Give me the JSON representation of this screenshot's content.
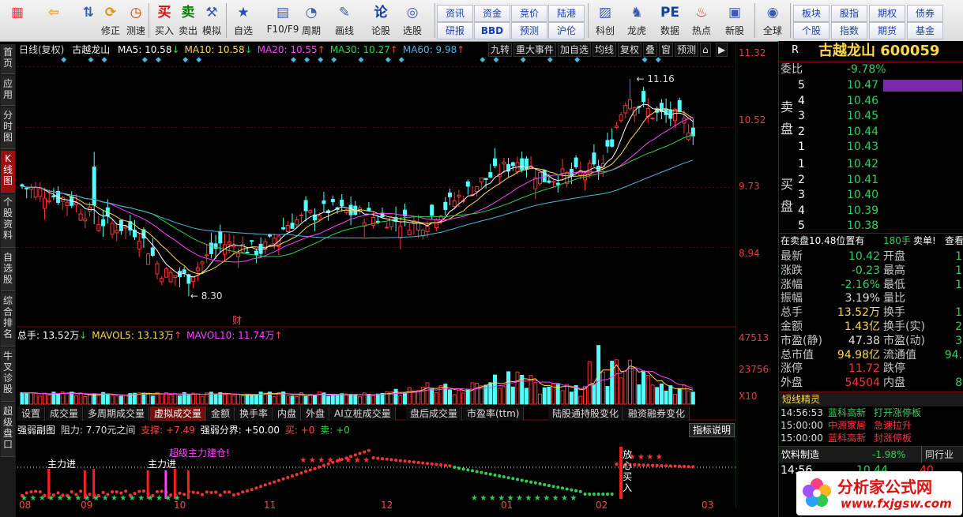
{
  "toolbar": {
    "main": [
      {
        "label": "",
        "icon": "app-grid-icon"
      },
      {
        "label": "",
        "icon": "back-arrow-icon"
      },
      {
        "label": "",
        "icon": "up-down-icon"
      },
      {
        "label": "修正",
        "icon": "refresh-icon"
      },
      {
        "label": "测速",
        "icon": "clock-icon"
      },
      {
        "label": "买入",
        "icon": "buy-icon",
        "glyph": "买"
      },
      {
        "label": "卖出",
        "icon": "sell-icon",
        "glyph": "卖"
      },
      {
        "label": "模拟",
        "icon": "hammer-icon"
      },
      {
        "label": "自选",
        "icon": "star-icon"
      },
      {
        "label": "F10/F9",
        "icon": "f10-icon"
      },
      {
        "label": "周期",
        "icon": "period-icon"
      },
      {
        "label": "画线",
        "icon": "pen-icon"
      },
      {
        "label": "论股",
        "icon": "forum-icon",
        "glyph": "论"
      },
      {
        "label": "选股",
        "icon": "select-icon"
      },
      {
        "label": "科创",
        "icon": "tech-icon"
      },
      {
        "label": "龙虎",
        "icon": "dragon-icon"
      },
      {
        "label": "数据",
        "icon": "data-icon",
        "glyph": "PE"
      },
      {
        "label": "热点",
        "icon": "hot-icon"
      },
      {
        "label": "新股",
        "icon": "newstock-icon"
      },
      {
        "label": "全球",
        "icon": "globe-icon"
      }
    ],
    "small_left": [
      "资讯",
      "资金",
      "竞价",
      "陆港",
      "研报",
      "BBD",
      "预测",
      "沪伦"
    ],
    "small_right": [
      "板块",
      "股指",
      "期权",
      "债券",
      "个股",
      "指数",
      "期货",
      "基金"
    ]
  },
  "left_tabs": [
    "首页",
    "应用",
    "分时图",
    "K线图",
    "个股资料",
    "自选股",
    "综合排名",
    "牛叉诊股",
    "超级盘口"
  ],
  "chart": {
    "header_title": "日线(复权)",
    "stock_name": "古越龙山",
    "ma": [
      {
        "label": "MA5: 10.58",
        "arrow": "↓",
        "color": "#ffffff"
      },
      {
        "label": "MA10: 10.58",
        "arrow": "↓",
        "color": "#ffd94a"
      },
      {
        "label": "MA20: 10.55",
        "arrow": "↑",
        "color": "#ff44ff"
      },
      {
        "label": "MA30: 10.27",
        "arrow": "↑",
        "color": "#30d050"
      },
      {
        "label": "MA60: 9.98",
        "arrow": "↑",
        "color": "#4ab8e0"
      }
    ],
    "top_buttons": [
      "九转",
      "重大事件",
      "加自选",
      "均线",
      "复权",
      "叠",
      "窗",
      "预测"
    ],
    "price_axis": [
      "11.32",
      "10.52",
      "9.73",
      "8.94"
    ],
    "high_label": "11.16",
    "low_label": "8.30",
    "finance_mark": "财",
    "volume_header": [
      {
        "label": "总手: 13.52万",
        "arrow": "↓",
        "color": "#ffffff"
      },
      {
        "label": "MAVOL5: 13.13万",
        "arrow": "↑",
        "color": "#ffd94a"
      },
      {
        "label": "MAVOL10: 11.74万",
        "arrow": "↑",
        "color": "#ff44ff"
      }
    ],
    "volume_axis": [
      "47513",
      "23756",
      "X10"
    ],
    "volume_tabs": [
      "设置",
      "成交量",
      "多周期成交量",
      "虚拟成交量",
      "金额",
      "换手率",
      "内盘",
      "外盘",
      "AI立桩成交量",
      "盘后成交量",
      "市盈率(ttm)",
      "陆股通持股变化",
      "融资融券变化"
    ],
    "active_tab": "虚拟成交量",
    "indicator_header": {
      "name": "强弱副图",
      "resist": "阻力: 7.70元之间",
      "support": "支撑: +7.49",
      "divider": "强弱分界: +50.00",
      "buy": "买: +0",
      "sell": "卖: +0"
    },
    "indicator_help": "指标说明",
    "annotations": {
      "main_in_1": "主力进",
      "main_in_2": "主力进",
      "super_build": "超级主力建仓!",
      "relax_buy": "放心买入"
    },
    "time_axis": [
      "08",
      "09",
      "10",
      "11",
      "12",
      "01",
      "02",
      "03"
    ]
  },
  "chart_data": {
    "type": "candlestick",
    "title": "古越龙山 日线(复权)",
    "price_range": [
      8.3,
      11.32
    ],
    "high": 11.16,
    "low": 8.3,
    "close_last": 10.42,
    "volume_max": 47513,
    "x_ticks": [
      "08",
      "09",
      "10",
      "11",
      "12",
      "01",
      "02",
      "03"
    ],
    "ma": {
      "MA5": 10.58,
      "MA10": 10.58,
      "MA20": 10.55,
      "MA30": 10.27,
      "MA60": 9.98
    },
    "mavol": {
      "总手": "13.52万",
      "MAVOL5": "13.13万",
      "MAVOL10": "11.74万"
    }
  },
  "right": {
    "code_label": "R",
    "stock_title": "古越龙山 600059",
    "weibi_label": "委比",
    "weibi_value": "-9.78%",
    "sell_side_label": "卖盘",
    "buy_side_label": "买盘",
    "asks": [
      {
        "level": "5",
        "price": "10.47"
      },
      {
        "level": "4",
        "price": "10.46"
      },
      {
        "level": "3",
        "price": "10.45"
      },
      {
        "level": "2",
        "price": "10.44"
      },
      {
        "level": "1",
        "price": "10.43"
      }
    ],
    "bids": [
      {
        "level": "1",
        "price": "10.42"
      },
      {
        "level": "2",
        "price": "10.41"
      },
      {
        "level": "3",
        "price": "10.40"
      },
      {
        "level": "4",
        "price": "10.39"
      },
      {
        "level": "5",
        "price": "10.38"
      }
    ],
    "status_line": "在卖盘10.48位置有",
    "status_qty": "180手",
    "status_action": "卖单!",
    "status_link": "查看",
    "quotes": [
      {
        "l1": "最新",
        "v1": "10.42",
        "c1": "val-g",
        "l2": "开盘",
        "v2": "1"
      },
      {
        "l1": "涨跌",
        "v1": "-0.23",
        "c1": "val-g",
        "l2": "最高",
        "v2": "1"
      },
      {
        "l1": "涨幅",
        "v1": "-2.16%",
        "c1": "val-g",
        "l2": "最低",
        "v2": "1"
      },
      {
        "l1": "振幅",
        "v1": "3.19%",
        "c1": "val-w",
        "l2": "量比",
        "v2": ""
      },
      {
        "l1": "总手",
        "v1": "13.52万",
        "c1": "val-y",
        "l2": "换手",
        "v2": "1"
      },
      {
        "l1": "金额",
        "v1": "1.43亿",
        "c1": "val-y",
        "l2": "换手(实)",
        "v2": "2"
      },
      {
        "l1": "市盈(静)",
        "v1": "47.38",
        "c1": "val-w",
        "l2": "市盈(动)",
        "v2": "3"
      },
      {
        "l1": "总市值",
        "v1": "94.98亿",
        "c1": "val-y",
        "l2": "流通值",
        "v2": "94."
      },
      {
        "l1": "涨停",
        "v1": "11.72",
        "c1": "val-r",
        "l2": "跌停",
        "v2": ""
      },
      {
        "l1": "外盘",
        "v1": "54504",
        "c1": "val-r",
        "l2": "内盘",
        "v2": "8"
      }
    ],
    "section_title": "短线精灵",
    "news": [
      {
        "time": "14:56:53",
        "stock": "蓝科高新",
        "event": "打开涨停板",
        "color": "#2fd15a"
      },
      {
        "time": "15:00:00",
        "stock": "中源家居",
        "event": "急速拉升",
        "color": "#ff3333"
      },
      {
        "time": "15:00:00",
        "stock": "蓝科高新",
        "event": "封涨停板",
        "color": "#ff3333"
      }
    ],
    "industry_label": "饮料制造",
    "industry_value": "-1.98%",
    "industry_tab": "同行业",
    "tick_time": "14:56",
    "tick_price": "10.44",
    "tick_vol": "40"
  },
  "logo": {
    "title": "分析家公式网",
    "url": "www.fxjgsw.com"
  },
  "colors": {
    "up": "#ff3333",
    "down": "#54ffff",
    "accent": "#7a0b0b",
    "ma5": "#ffffff",
    "ma10": "#ffd94a",
    "ma20": "#ff44ff",
    "ma30": "#30d050",
    "ma60": "#4ab8e0"
  }
}
